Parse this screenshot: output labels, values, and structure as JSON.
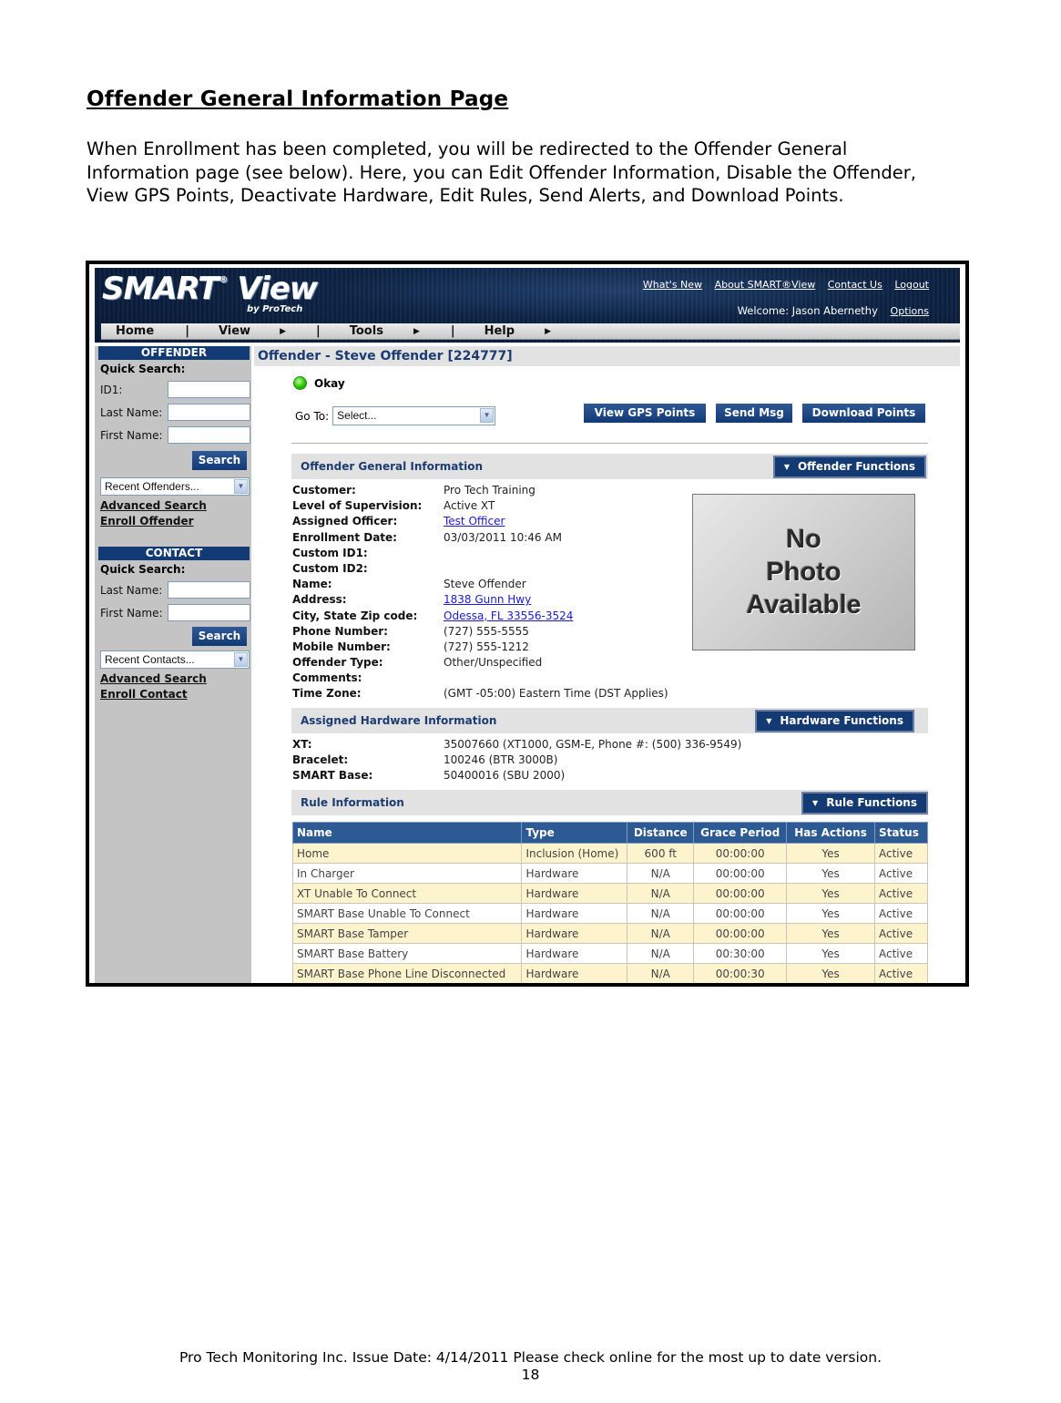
{
  "document": {
    "title": "Offender General Information Page",
    "intro": "When Enrollment has been completed, you will be redirected to the Offender General Information page (see below).  Here, you can Edit Offender Information, Disable the Offender, View GPS Points, Deactivate Hardware, Edit Rules, Send Alerts, and Download Points.",
    "footer_line": "Pro Tech Monitoring Inc. Issue Date: 4/14/2011 Please check online for the most up to date version.",
    "page_number": "18"
  },
  "app": {
    "logo": "SMART",
    "logo_reg": "®",
    "logo_view": " View",
    "logo_sub": "by ProTech",
    "top_links": [
      "What's New",
      "About SMART®View",
      "Contact Us",
      "Logout"
    ],
    "welcome": "Welcome: Jason Abernethy",
    "options": "Options",
    "menu": {
      "home": "Home",
      "view": "View",
      "tools": "Tools",
      "help": "Help",
      "separator": "|",
      "arrow": "▶"
    }
  },
  "sidebar": {
    "offender": {
      "header": "OFFENDER",
      "quick_search": "Quick Search:",
      "fields": [
        "ID1:",
        "Last Name:",
        "First Name:"
      ],
      "search_button": "Search",
      "recent": "Recent Offenders...",
      "links": [
        "Advanced Search",
        "Enroll Offender"
      ]
    },
    "contact": {
      "header": "CONTACT",
      "quick_search": "Quick Search:",
      "fields": [
        "Last Name:",
        "First Name:"
      ],
      "search_button": "Search",
      "recent": "Recent Contacts...",
      "links": [
        "Advanced Search",
        "Enroll Contact"
      ]
    }
  },
  "main": {
    "title": "Offender - Steve Offender [224777]",
    "status": "Okay",
    "status_color": "#27c400",
    "goto_label": "Go To:",
    "goto_value": "Select...",
    "buttons": {
      "view_gps": "View GPS Points",
      "send_msg": "Send Msg",
      "download": "Download Points"
    },
    "general": {
      "header": "Offender General Information",
      "functions_button": "Offender Functions",
      "rows": [
        {
          "label": "Customer:",
          "value": "Pro Tech Training"
        },
        {
          "label": "Level of Supervision:",
          "value": "Active XT"
        },
        {
          "label": "Assigned Officer:",
          "value": "Test Officer"
        },
        {
          "label": "Enrollment Date:",
          "value": "03/03/2011 10:46 AM"
        },
        {
          "label": "Custom ID1:",
          "value": ""
        },
        {
          "label": "Custom ID2:",
          "value": ""
        },
        {
          "label": "Name:",
          "value": "Steve Offender"
        },
        {
          "label": "Address:",
          "value": "1838 Gunn Hwy"
        },
        {
          "label": "City, State Zip code:",
          "value": "Odessa, FL 33556-3524"
        },
        {
          "label": "Phone Number:",
          "value": "(727) 555-5555"
        },
        {
          "label": "Mobile Number:",
          "value": "(727) 555-1212"
        },
        {
          "label": "Offender Type:",
          "value": "Other/Unspecified"
        },
        {
          "label": "Comments:",
          "value": ""
        },
        {
          "label": "Time Zone:",
          "value": "(GMT -05:00) Eastern Time (DST Applies)"
        }
      ],
      "photo": [
        "No",
        "Photo",
        "Available"
      ]
    },
    "hardware": {
      "header": "Assigned Hardware Information",
      "functions_button": "Hardware Functions",
      "rows": [
        {
          "label": "XT:",
          "value": "35007660 (XT1000, GSM-E, Phone #: (500) 336-9549)"
        },
        {
          "label": "Bracelet:",
          "value": "100246 (BTR 3000B)"
        },
        {
          "label": "SMART Base:",
          "value": "50400016 (SBU 2000)"
        }
      ]
    },
    "rules": {
      "header": "Rule Information",
      "functions_button": "Rule Functions",
      "columns": [
        "Name",
        "Type",
        "Distance",
        "Grace Period",
        "Has Actions",
        "Status"
      ],
      "rows": [
        [
          "Home",
          "Inclusion (Home)",
          "600 ft",
          "00:00:00",
          "Yes",
          "Active"
        ],
        [
          "In Charger",
          "Hardware",
          "N/A",
          "00:00:00",
          "Yes",
          "Active"
        ],
        [
          "XT Unable To Connect",
          "Hardware",
          "N/A",
          "00:00:00",
          "Yes",
          "Active"
        ],
        [
          "SMART Base Unable To Connect",
          "Hardware",
          "N/A",
          "00:00:00",
          "Yes",
          "Active"
        ],
        [
          "SMART Base Tamper",
          "Hardware",
          "N/A",
          "00:00:00",
          "Yes",
          "Active"
        ],
        [
          "SMART Base Battery",
          "Hardware",
          "N/A",
          "00:30:00",
          "Yes",
          "Active"
        ],
        [
          "SMART Base Phone Line Disconnected",
          "Hardware",
          "N/A",
          "00:00:30",
          "Yes",
          "Active"
        ]
      ]
    }
  }
}
